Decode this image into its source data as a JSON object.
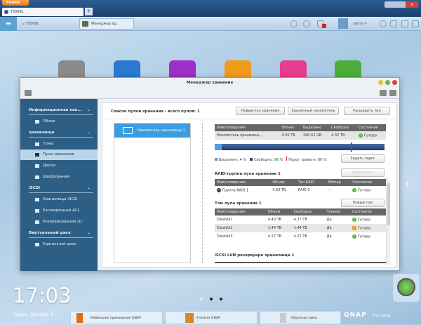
{
  "browser": {
    "menu_button": "Firefox",
    "tab_title": "TS569L",
    "new_tab": "+",
    "close": "x"
  },
  "toolbar": {
    "menu_icon": "≡",
    "home_label": "TS569L",
    "app_tab": "Менеджер хр..",
    "user": "admin ▾"
  },
  "window": {
    "title": "Менеджер хранения"
  },
  "sidebar": {
    "groups": [
      {
        "label": "Информационная пан..."
      },
      {
        "label": "хранилище"
      },
      {
        "label": "iSCSI"
      },
      {
        "label": "Виртуальный диск"
      }
    ],
    "items": [
      {
        "label": "Обзор"
      },
      {
        "label": "Тома"
      },
      {
        "label": "Пулы хранения"
      },
      {
        "label": "Диски"
      },
      {
        "label": "Шифрование"
      },
      {
        "label": "Хранилища iSCSI"
      },
      {
        "label": "Расширенный ACL"
      },
      {
        "label": "Резервирование LU"
      },
      {
        "label": "Удаленный диск"
      }
    ],
    "chevron": "⌄"
  },
  "main": {
    "list_title": "Список пулов хранения - всего пулов: 1",
    "buttons": {
      "new_pool": "Новый пул хранения",
      "remove": "Удаленный накопитель",
      "expand": "Расширить пул",
      "set_threshold": "Задать порог",
      "manage": "Управлять",
      "new_volume": "Новый том"
    },
    "pools": [
      {
        "name": "Накопитель хранилища 1"
      }
    ],
    "pool_table": {
      "headers": [
        "Имя/псевдоним",
        "Объем",
        "Выделено",
        "Свободно",
        "Состояние"
      ],
      "rows": [
        [
          "Накопитель хранилищ...",
          "4.50 TB",
          "190.42 GB",
          "4.32 TB",
          "Готово"
        ]
      ]
    },
    "usage": {
      "allocated_percent": 4,
      "free_percent": 96,
      "threshold_percent": 80,
      "legend_allocated": "Выделено: 4 %",
      "legend_free": "Свободно: 96 %",
      "legend_threshold": "Порог тревоги: 80 %",
      "colors": {
        "allocated": "#4f9fe0",
        "free": "#2a4a7d",
        "threshold": "#dd2222"
      }
    },
    "raid_title": "RAID-группа пула хранения 1",
    "raid_table": {
      "headers": [
        "Имя/псевдоним",
        "Объем",
        "Тип RAID",
        "Bitmap",
        "Состояние"
      ],
      "rows": [
        [
          "Группа RAID 1",
          "4.50 TB",
          "RAID 0",
          "--",
          "Готово"
        ]
      ]
    },
    "volume_title": "Том пула хранения 1",
    "volume_table": {
      "headers": [
        "Имя/псевдоним",
        "Объем",
        "Свободно",
        "Тонкий",
        "Состояние"
      ],
      "rows": [
        [
          "DataVol1",
          "4.43 TB",
          "4.37 TB",
          "Да",
          "Готово"
        ],
        [
          "DataVol2",
          "1.44 TB",
          "1.44 TB",
          "Да",
          "Готово"
        ],
        [
          "DataVol3",
          "4.27 TB",
          "4.27 TB",
          "Да",
          "Готово"
        ]
      ]
    },
    "iscsi_title": "iSCSI LUN резервуара хранилища 1"
  },
  "desktop": {
    "time": "17:03",
    "date": "Среда, Декабрь 4",
    "brand": "QNAP",
    "model": "TS-569L",
    "right_arrow": "›",
    "dock": [
      {
        "label": "Мобильное приложение QNAP"
      },
      {
        "label": "Утилита QNAP"
      },
      {
        "label": "Обратная связь"
      }
    ]
  }
}
